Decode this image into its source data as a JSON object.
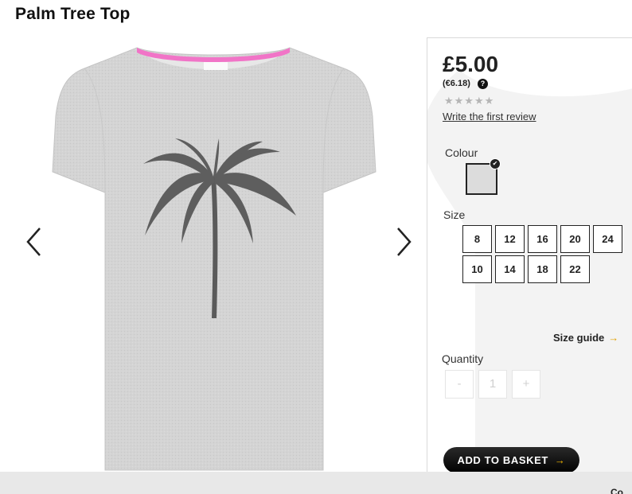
{
  "product": {
    "title": "Palm Tree Top",
    "price": "£5.00",
    "alt_price": "(€6.18)",
    "help_symbol": "?",
    "stars": "★★★★★",
    "rating": 0,
    "review_link": "Write the first review"
  },
  "colour": {
    "label": "Colour",
    "selected_color": "#dcdcdc",
    "check": "✔"
  },
  "size": {
    "label": "Size",
    "options": [
      "8",
      "12",
      "16",
      "20",
      "24",
      "10",
      "14",
      "18",
      "22"
    ],
    "guide_label": "Size guide",
    "guide_chevron": "→"
  },
  "quantity": {
    "label": "Quantity",
    "minus": "-",
    "value": "1",
    "plus": "+"
  },
  "basket": {
    "label": "ADD TO BASKET",
    "chevron": "→"
  },
  "footer": {
    "text": "Co"
  },
  "icons": {
    "prev": "chevron-left-icon",
    "next": "chevron-right-icon",
    "help": "question-circle-icon"
  }
}
